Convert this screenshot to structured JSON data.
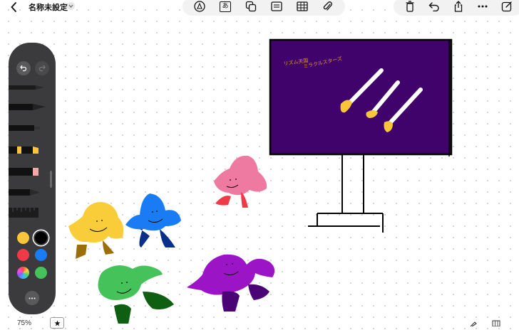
{
  "app": {
    "document_title": "名称未設定",
    "zoom_level": "75%"
  },
  "toolbar_center": {
    "items": [
      {
        "icon": "pen-tool-icon",
        "label": ""
      },
      {
        "icon": "text-box-icon",
        "label": "あ"
      },
      {
        "icon": "shapes-icon",
        "label": ""
      },
      {
        "icon": "sticky-note-icon",
        "label": ""
      },
      {
        "icon": "table-icon",
        "label": ""
      },
      {
        "icon": "paperclip-icon",
        "label": ""
      }
    ]
  },
  "toolbar_right": {
    "items": [
      {
        "icon": "trash-icon"
      },
      {
        "icon": "undo-icon"
      },
      {
        "icon": "share-icon"
      },
      {
        "icon": "more-icon"
      },
      {
        "icon": "compose-icon"
      }
    ]
  },
  "palette": {
    "tools": [
      "pen",
      "marker",
      "fineliner",
      "highlighter",
      "eraser",
      "pencil",
      "ruler"
    ],
    "colors": [
      {
        "name": "yellow",
        "hex": "#f9c53b"
      },
      {
        "name": "black",
        "hex": "#000000",
        "selected": true
      },
      {
        "name": "red",
        "hex": "#f03a47"
      },
      {
        "name": "blue",
        "hex": "#1a7cf5"
      },
      {
        "name": "color-wheel",
        "hex": "multicolor"
      },
      {
        "name": "green",
        "hex": "#45c35a"
      }
    ]
  },
  "board": {
    "caption_line1": "リズム天国",
    "caption_line2": "ミラクルスターズ",
    "board_color": "#3f036b",
    "caption_color": "#e59a2a"
  }
}
